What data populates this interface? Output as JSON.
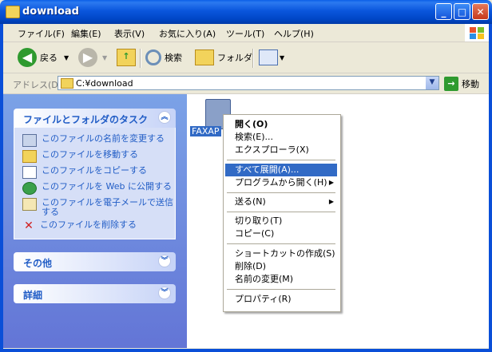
{
  "window": {
    "title": "download"
  },
  "menubar": {
    "items": [
      "ファイル(F)",
      "編集(E)",
      "表示(V)",
      "お気に入り(A)",
      "ツール(T)",
      "ヘルプ(H)"
    ]
  },
  "toolbar": {
    "back_label": "戻る",
    "search_label": "検索",
    "folders_label": "フォルダ"
  },
  "address": {
    "label": "アドレス(D)",
    "value": "C:¥download",
    "go_label": "移動"
  },
  "tasks_panel": {
    "title": "ファイルとフォルダのタスク",
    "items": [
      "このファイルの名前を変更する",
      "このファイルを移動する",
      "このファイルをコピーする",
      "このファイルを Web に公開する",
      "このファイルを電子メールで送信する",
      "このファイルを削除する"
    ]
  },
  "other_panel": {
    "title": "その他"
  },
  "details_panel": {
    "title": "詳細"
  },
  "file": {
    "name": "FAXAP"
  },
  "context_menu": {
    "open": "開く(O)",
    "search": "検索(E)...",
    "explorer": "エクスプローラ(X)",
    "extract_all": "すべて展開(A)...",
    "open_with": "プログラムから開く(H)",
    "send_to": "送る(N)",
    "cut": "切り取り(T)",
    "copy": "コピー(C)",
    "create_shortcut": "ショートカットの作成(S)",
    "delete": "削除(D)",
    "rename": "名前の変更(M)",
    "properties": "プロパティ(R)"
  }
}
